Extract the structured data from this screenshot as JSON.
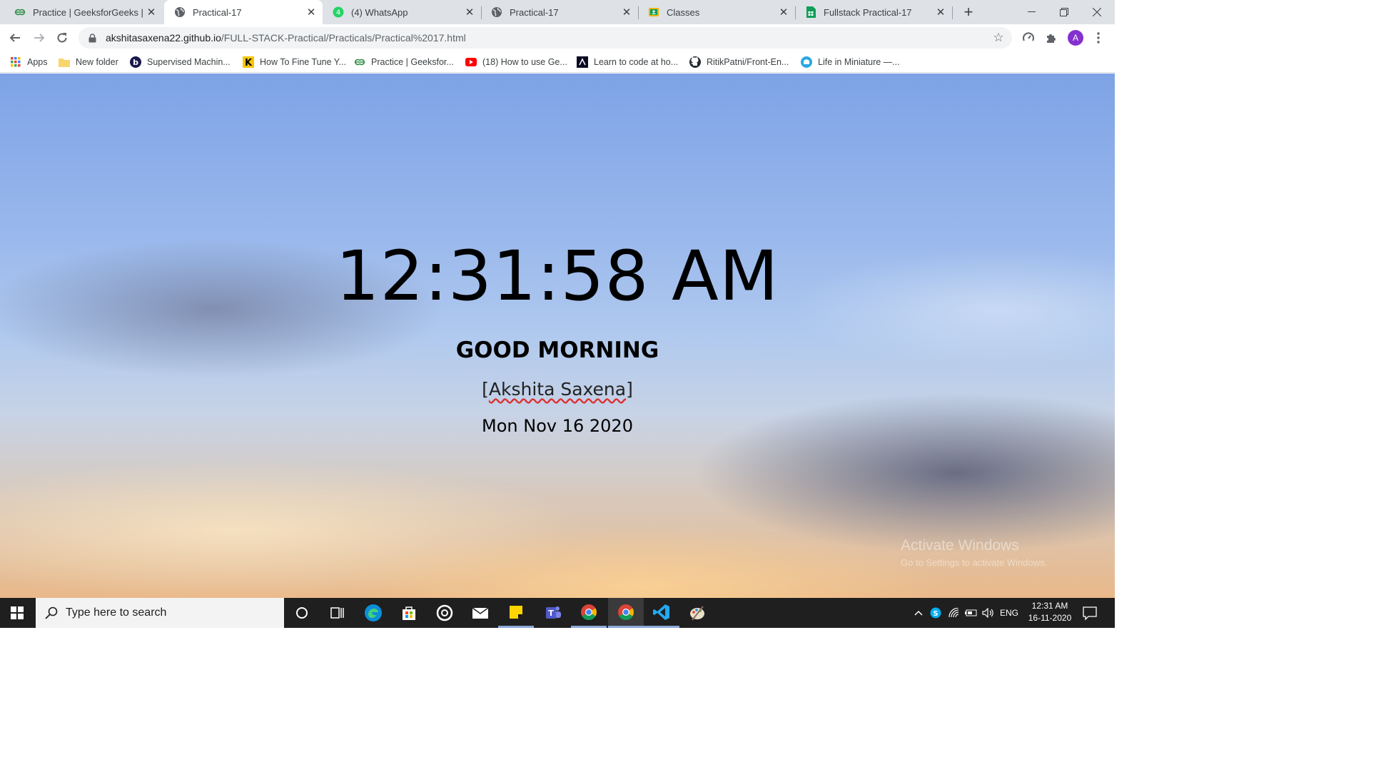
{
  "browser": {
    "tabs": [
      {
        "title": "Practice | GeeksforGeeks | A c",
        "icon": "geeksforgeeks-icon",
        "active": false
      },
      {
        "title": "Practical-17",
        "icon": "globe-icon",
        "active": true
      },
      {
        "title": "(4) WhatsApp",
        "icon": "whatsapp-icon",
        "active": false
      },
      {
        "title": "Practical-17",
        "icon": "globe-icon",
        "active": false
      },
      {
        "title": "Classes",
        "icon": "google-classroom-icon",
        "active": false
      },
      {
        "title": "Fullstack Practical-17",
        "icon": "google-sheets-icon",
        "active": false
      }
    ],
    "url_host": "akshitasaxena22.github.io",
    "url_path": "/FULL-STACK-Practical/Practicals/Practical%2017.html",
    "profile_initial": "A",
    "bookmarks": [
      {
        "label": "Apps",
        "icon": "apps-grid-icon"
      },
      {
        "label": "New folder",
        "icon": "folder-icon"
      },
      {
        "label": "Supervised Machin...",
        "icon": "b-circle-icon"
      },
      {
        "label": "How To Fine Tune Y...",
        "icon": "k-logo-icon"
      },
      {
        "label": "Practice | Geeksfor...",
        "icon": "geeksforgeeks-icon"
      },
      {
        "label": "(18) How to use Ge...",
        "icon": "youtube-icon"
      },
      {
        "label": "Learn to code at ho...",
        "icon": "freecodecamp-icon"
      },
      {
        "label": "RitikPatni/Front-En...",
        "icon": "github-icon"
      },
      {
        "label": "Life in Miniature —...",
        "icon": "globe-blue-icon"
      }
    ]
  },
  "page": {
    "time": "12:31:58 AM",
    "greeting": "GOOD MORNING",
    "name_open": "[",
    "name_text": "Akshita Saxena",
    "name_close": "]",
    "date": "Mon Nov 16 2020",
    "watermark_title": "Activate Windows",
    "watermark_sub": "Go to Settings to activate Windows."
  },
  "taskbar": {
    "search_placeholder": "Type here to search",
    "language": "ENG",
    "time": "12:31 AM",
    "date": "16-11-2020"
  },
  "colors": {
    "avatar": "#8430ce",
    "taskbar": "#1f1f1f",
    "tabstrip": "#dee1e6"
  }
}
